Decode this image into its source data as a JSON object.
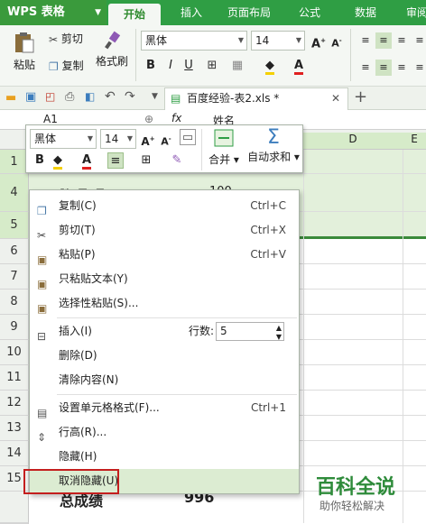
{
  "titlebar": {
    "app": "WPS 表格",
    "tabs": [
      "开始",
      "插入",
      "页面布局",
      "公式",
      "数据",
      "审阅"
    ]
  },
  "ribbon": {
    "paste": "粘贴",
    "cut": "剪切",
    "copy": "复制",
    "format_painter": "格式刷",
    "font": "黑体",
    "size": "14",
    "bold": "B",
    "italic": "I",
    "underline": "U"
  },
  "docbar": {
    "doc_name": "百度经验-表2.xls *"
  },
  "formula": {
    "namebox": "A1",
    "fx": "fx",
    "value": "姓名"
  },
  "columns": [
    "D",
    "E"
  ],
  "rows": [
    "1",
    "4",
    "5",
    "6",
    "7",
    "8",
    "9",
    "10",
    "11",
    "12",
    "13",
    "14",
    "15"
  ],
  "cells": {
    "row4_a": "胜 风 月",
    "row4_b": "100",
    "row14_a": "总成绩",
    "row14_b": "996"
  },
  "mini_toolbar": {
    "font": "黑体",
    "size": "14",
    "merge": "合并",
    "autosum": "自动求和"
  },
  "menu": {
    "copy": "复制(C)",
    "copy_sc": "Ctrl+C",
    "cut": "剪切(T)",
    "cut_sc": "Ctrl+X",
    "paste": "粘贴(P)",
    "paste_sc": "Ctrl+V",
    "paste_text": "只粘贴文本(Y)",
    "paste_special": "选择性粘贴(S)...",
    "insert": "插入(I)",
    "rows_label": "行数:",
    "rows_value": "5",
    "delete": "删除(D)",
    "clear": "清除内容(N)",
    "format_cells": "设置单元格格式(F)...",
    "format_sc": "Ctrl+1",
    "row_height": "行高(R)...",
    "hide": "隐藏(H)",
    "unhide": "取消隐藏(U)"
  },
  "watermark": {
    "title": "百科全说",
    "subtitle": "助你轻松解决"
  },
  "colors": {
    "brand": "#2f9e44",
    "selection": "#e3f0db",
    "highlight": "#c41e1e"
  }
}
